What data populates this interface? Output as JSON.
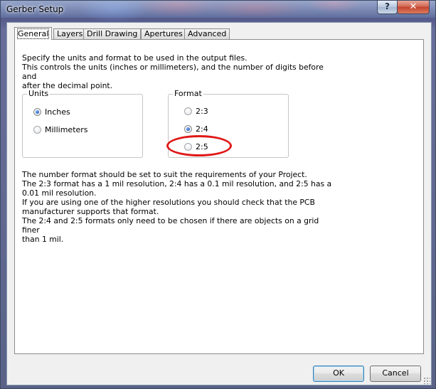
{
  "window": {
    "title": "Gerber Setup",
    "help_glyph": "?",
    "close_glyph": "✕"
  },
  "tabs": [
    {
      "label": "General",
      "active": true
    },
    {
      "label": "Layers",
      "active": false
    },
    {
      "label": "Drill Drawing",
      "active": false
    },
    {
      "label": "Apertures",
      "active": false
    },
    {
      "label": "Advanced",
      "active": false
    }
  ],
  "general": {
    "intro": "Specify the units and format to be used in the output files.\nThis controls the units (inches or millimeters), and the number of digits before and\nafter the decimal point.",
    "units": {
      "label": "Units",
      "options": [
        {
          "label": "Inches",
          "selected": true
        },
        {
          "label": "Millimeters",
          "selected": false
        }
      ]
    },
    "format": {
      "label": "Format",
      "options": [
        {
          "label": "2:3",
          "selected": false
        },
        {
          "label": "2:4",
          "selected": true
        },
        {
          "label": "2:5",
          "selected": false
        }
      ]
    },
    "notes": "The number format should be set to suit the requirements of your Project.\nThe 2:3 format has a 1 mil resolution, 2:4 has a 0.1 mil resolution, and 2:5 has a\n0.01 mil resolution.\nIf you are using one of the higher resolutions you should check that the PCB\nmanufacturer supports that format.\nThe 2:4 and 2:5 formats only need to be chosen if there are objects on a grid finer\nthan 1 mil."
  },
  "buttons": {
    "ok": "OK",
    "cancel": "Cancel"
  },
  "colors": {
    "highlight": "#e01818",
    "close_button": "#c4452e"
  }
}
